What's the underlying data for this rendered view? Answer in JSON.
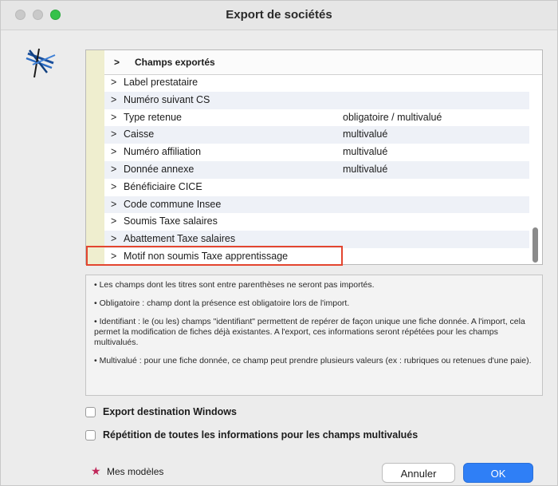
{
  "window": {
    "title": "Export de sociétés"
  },
  "fields": {
    "header": "Champs exportés",
    "rows": [
      {
        "label": "Label prestataire",
        "value": ""
      },
      {
        "label": "Numéro suivant CS",
        "value": ""
      },
      {
        "label": "Type retenue",
        "value": "obligatoire / multivalué"
      },
      {
        "label": "Caisse",
        "value": "multivalué"
      },
      {
        "label": "Numéro affiliation",
        "value": "multivalué"
      },
      {
        "label": "Donnée annexe",
        "value": "multivalué"
      },
      {
        "label": "Bénéficiaire CICE",
        "value": ""
      },
      {
        "label": "Code commune Insee",
        "value": ""
      },
      {
        "label": "Soumis Taxe salaires",
        "value": ""
      },
      {
        "label": "Abattement Taxe salaires",
        "value": ""
      },
      {
        "label": "Motif non soumis Taxe apprentissage",
        "value": ""
      }
    ]
  },
  "notes": {
    "n1": "• Les champs dont les titres sont entre parenthèses ne seront pas importés.",
    "n2": "• Obligatoire : champ dont la présence est obligatoire lors de l'import.",
    "n3": "• Identifiant : le (ou les) champs \"identifiant\" permettent de repérer de façon unique une fiche donnée. A l'import, cela permet la modification de fiches déjà existantes. A l'export, ces informations seront répétées pour les champs multivalués.",
    "n4": "• Multivalué : pour une fiche donnée, ce champ peut prendre plusieurs valeurs (ex : rubriques ou retenues d'une paie)."
  },
  "options": {
    "export_windows": "Export destination Windows",
    "repeat_info": "Répétition de toutes les informations pour les champs multivalués"
  },
  "footer": {
    "models_label": "Mes modèles",
    "cancel_label": "Annuler",
    "ok_label": "OK"
  },
  "colors": {
    "highlight": "#e3452f",
    "ok_button": "#2f7ff6",
    "star": "#c0275a"
  }
}
